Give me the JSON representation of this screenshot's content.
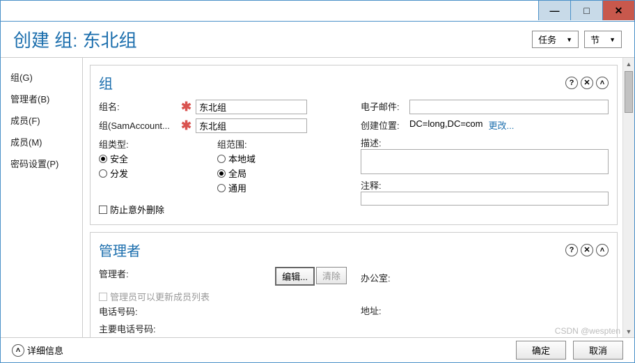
{
  "titlebar": {
    "minimize": "—",
    "maximize": "□",
    "close": "✕"
  },
  "header": {
    "title": "创建 组: 东北组",
    "tasks_label": "任务",
    "section_label": "节"
  },
  "sidebar": {
    "items": [
      {
        "label": "组(G)"
      },
      {
        "label": "管理者(B)"
      },
      {
        "label": "成员(F)"
      },
      {
        "label": "成员(M)"
      },
      {
        "label": "密码设置(P)"
      }
    ]
  },
  "group_section": {
    "title": "组",
    "name_label": "组名:",
    "name_value": "东北组",
    "sam_label": "组(SamAccount...",
    "sam_value": "东北组",
    "type_label": "组类型:",
    "type_opts": {
      "security": "安全",
      "distribution": "分发"
    },
    "scope_label": "组范围:",
    "scope_opts": {
      "local": "本地域",
      "global": "全局",
      "universal": "通用"
    },
    "protect_label": "防止意外删除",
    "email_label": "电子邮件:",
    "created_in_label": "创建位置:",
    "created_in_value": "DC=long,DC=com",
    "change_link": "更改...",
    "desc_label": "描述:",
    "notes_label": "注释:",
    "required": "✱"
  },
  "manager_section": {
    "title": "管理者",
    "manager_label": "管理者:",
    "edit_btn": "编辑...",
    "clear_btn": "清除",
    "can_update_label": "管理员可以更新成员列表",
    "phone_label": "电话号码:",
    "main_phone_label": "主要电话号码:",
    "office_label": "办公室:",
    "address_label": "地址:"
  },
  "footer": {
    "details": "详细信息",
    "ok": "确定",
    "cancel": "取消"
  },
  "watermark": "CSDN @wespten"
}
